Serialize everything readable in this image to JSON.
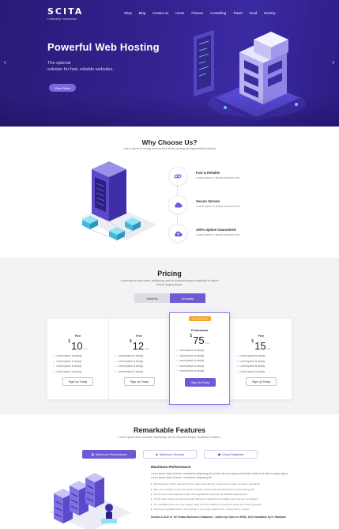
{
  "header": {
    "brand": "SCITA",
    "tagline": "Company Innovation",
    "nav": [
      "Shop",
      "Blog",
      "Contact us",
      "Home",
      "Finance",
      "Consulting",
      "Travel",
      "Food",
      "Dummy"
    ]
  },
  "hero": {
    "title": "Powerful Web Hosting",
    "subtitle_line1": "The optimal",
    "subtitle_line2": "solution for fast, reliable websites.",
    "cta": "View Plans",
    "prev_glyph": "‹",
    "next_glyph": "›"
  },
  "why": {
    "title": "Why Choose Us?",
    "subtitle": "Lorem Ipsum is simply dummy text of the printing and typesetting industry.",
    "features": [
      {
        "title": "Fast & Reliable",
        "desc": "Lorem ipsum is simple dummm test",
        "icon": "link-icon"
      },
      {
        "title": "Secure Servers",
        "desc": "Lorem ipsum is simple dummm test",
        "icon": "cloud-icon"
      },
      {
        "title": "100% Uptime Guaranteed",
        "desc": "Lorem ipsum is simple dummm test",
        "icon": "cloud-upload-icon"
      }
    ]
  },
  "pricing": {
    "title": "Pricing",
    "subtitle_line1": "Lorem ipsum dolor amet, adipiscing, sed do eiusmod tempor incididunt ut labore",
    "subtitle_line2": "dolore magna aliqua.",
    "toggle": {
      "monthly": "Monthly",
      "annually": "Annually",
      "active": "annually"
    },
    "currency": "$",
    "per": "/mo",
    "plans": [
      {
        "name": "Free",
        "price": "10",
        "badge": "",
        "features": [
          "Lorem ipsum is simply",
          "Lorem ipsum is simply",
          "Lorem ipsum is simply",
          "Lorem ipsum is simply"
        ],
        "cta": "Sign Up Today"
      },
      {
        "name": "Free",
        "price": "12",
        "badge": "",
        "features": [
          "Lorem ipsum is simply",
          "Lorem ipsum is simply",
          "Lorem ipsum is simply",
          "Lorem ipsum is simply"
        ],
        "cta": "Sign Up Today"
      },
      {
        "name": "Professional",
        "price": "75",
        "badge": "Recommended",
        "features": [
          "Lorem ipsum is simply",
          "Lorem ipsum is simply",
          "Lorem ipsum is simply",
          "Lorem ipsum is simply",
          "Lorem ipsum is simply"
        ],
        "cta": "Sign Up Today"
      },
      {
        "name": "Free",
        "price": "15",
        "badge": "",
        "features": [
          "Lorem ipsum is simply",
          "Lorem ipsum is simply",
          "Lorem ipsum is simply",
          "Lorem ipsum is simply"
        ],
        "cta": "Sign Up Today"
      }
    ]
  },
  "features": {
    "title": "Remarkable Features",
    "subtitle": "Lorem ipsum dolor sit amet, adipiscing, sed do eiusmod tempor incididunt ut labore",
    "tabs": [
      {
        "label": "Maximum Performance",
        "icon": "chart-icon",
        "active": true
      },
      {
        "label": "Maximum Security",
        "icon": "shield-icon",
        "active": false
      },
      {
        "label": "Cloud Database",
        "icon": "database-icon",
        "active": false
      }
    ],
    "panel": {
      "title": "Maximum Performance",
      "paragraph": "Lorem ipsum dolor sit amet, consectetur adipiscing elit, sed do eiusmod tempor incididunt ut labore et dolore magna aliqua. Lorem ipsum dolor sit amet, consectetur adipiscing elit.",
      "bullets": [
        "Special jargon with a document to be edits some old any content set in a free computer operations",
        "But I must explain to you how all this mistaken idea of denouncing pleasure and praising pain",
        "At vero eos et accusamus et iusto odio dignissimos ducimus qui blanditiis praesentium",
        "On the other hand, we denounce with righteous indignation and dislike men who are so beguiled",
        "The standard chunk of Lorem Ipsum used since the 1500s is reproduced below for those interested",
        "Contrary to popular belief, Lorem Ipsum is not simply random text, it has roots in a piece"
      ],
      "footnote": "Section 1.10.32 of \"de Finibus Bonorum et Malorum\", written by Cicero in 45 BC, 1914 translation by H. Rackham"
    }
  },
  "colors": {
    "accent": "#6d5bd6",
    "hero_bg": "#34228f",
    "badge": "#f5a623"
  }
}
